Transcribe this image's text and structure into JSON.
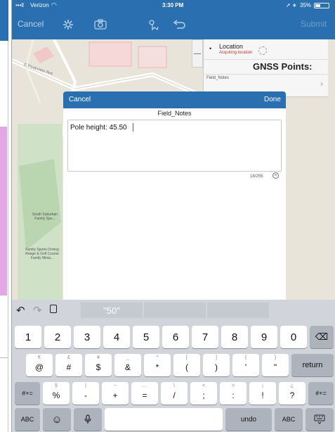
{
  "status_bar": {
    "carrier": "Verizon",
    "time": "3:30 PM",
    "battery": "35%"
  },
  "toolbar": {
    "cancel_label": "Cancel",
    "submit_label": "Submit"
  },
  "map": {
    "street_label": "E Peakview Ave",
    "label_school": "South Suburban Family Spo...",
    "label_sports": "Family Sports Driving Range & Golf Course Family Minia..."
  },
  "gnss_panel": {
    "location_label": "Location",
    "location_status": "Acquiring location",
    "title": "GNSS Points:",
    "field_label": "Field_Notes"
  },
  "modal": {
    "cancel_label": "Cancel",
    "done_label": "Done",
    "field_title": "Field_Notes",
    "value": "Pole height: 45.50",
    "char_count": "18/255"
  },
  "keyboard": {
    "suggestion": "\"50\"",
    "row1": [
      {
        "label": "1"
      },
      {
        "label": "2"
      },
      {
        "label": "3"
      },
      {
        "label": "4"
      },
      {
        "label": "5"
      },
      {
        "label": "6"
      },
      {
        "label": "7"
      },
      {
        "label": "8"
      },
      {
        "label": "9"
      },
      {
        "label": "0"
      }
    ],
    "row2": [
      {
        "alt": "€",
        "label": "@"
      },
      {
        "alt": "£",
        "label": "#"
      },
      {
        "alt": "¥",
        "label": "$"
      },
      {
        "alt": "_",
        "label": "&"
      },
      {
        "alt": "^",
        "label": "*"
      },
      {
        "alt": "[",
        "label": "("
      },
      {
        "alt": "]",
        "label": ")"
      },
      {
        "alt": "{",
        "label": "'"
      },
      {
        "alt": "}",
        "label": "\""
      }
    ],
    "return_label": "return",
    "row3": [
      {
        "alt": "§",
        "label": "%"
      },
      {
        "alt": "|",
        "label": "-"
      },
      {
        "alt": "~",
        "label": "+"
      },
      {
        "alt": "…",
        "label": "="
      },
      {
        "alt": "\\",
        "label": "/"
      },
      {
        "alt": "<",
        "label": ";"
      },
      {
        "alt": ">",
        "label": ":"
      },
      {
        "alt": "¡",
        "label": "!"
      },
      {
        "alt": "¿",
        "label": "?"
      }
    ],
    "shift_label": "#+=",
    "abc_label": "ABC",
    "undo_label": "undo"
  },
  "icons": {
    "gear": "gear-icon",
    "camera": "camera-icon",
    "drag": "drag-icon",
    "undo": "undo-icon",
    "backspace": "backspace-icon",
    "emoji": "emoji-icon",
    "mic": "mic-icon",
    "keyboard_hide": "keyboard-hide-icon"
  },
  "colors": {
    "accent": "#2a6fb0",
    "keyboard_bg": "#d1d5db"
  }
}
